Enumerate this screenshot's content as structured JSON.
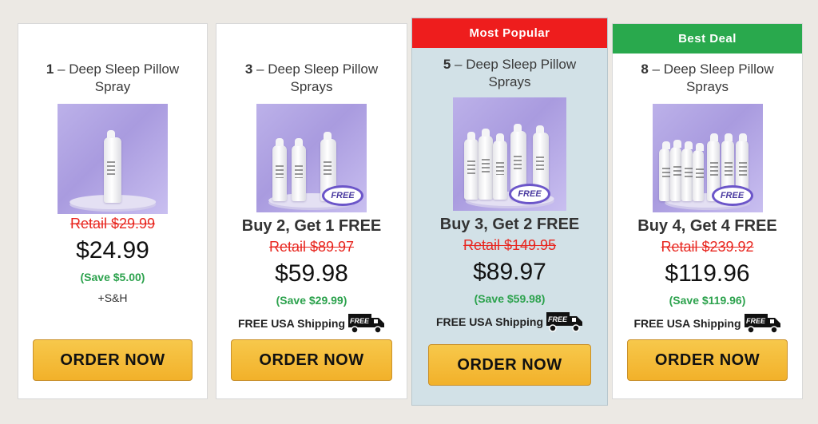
{
  "cards": [
    {
      "qty": "1",
      "title": "– Deep Sleep Pillow Spray",
      "ribbon": "",
      "offer": "",
      "retail": "Retail $29.99",
      "price": "$24.99",
      "save": "(Save $5.00)",
      "extra": "+S&H",
      "shipping": "",
      "button": "ORDER NOW"
    },
    {
      "qty": "3",
      "title": "– Deep Sleep Pillow Sprays",
      "ribbon": "",
      "offer": "Buy 2, Get 1 FREE",
      "retail": "Retail $89.97",
      "price": "$59.98",
      "save": "(Save $29.99)",
      "extra": "",
      "shipping": "FREE USA Shipping",
      "button": "ORDER NOW",
      "badge": "FREE"
    },
    {
      "qty": "5",
      "title": "– Deep Sleep Pillow Sprays",
      "ribbon": "Most Popular",
      "offer": "Buy 3, Get 2 FREE",
      "retail": "Retail $149.95",
      "price": "$89.97",
      "save": "(Save $59.98)",
      "extra": "",
      "shipping": "FREE USA Shipping",
      "button": "ORDER NOW",
      "badge": "FREE"
    },
    {
      "qty": "8",
      "title": "– Deep Sleep Pillow Sprays",
      "ribbon": "Best Deal",
      "offer": "Buy 4, Get 4 FREE",
      "retail": "Retail $239.92",
      "price": "$119.96",
      "save": "(Save $119.96)",
      "extra": "",
      "shipping": "FREE USA Shipping",
      "button": "ORDER NOW",
      "badge": "FREE"
    }
  ],
  "truck_label": "FREE",
  "colors": {
    "popular_ribbon": "#ee1d1d",
    "best_ribbon": "#29a94d",
    "retail": "#e8261f",
    "save": "#2ca24d",
    "button": "#f2b12a"
  }
}
